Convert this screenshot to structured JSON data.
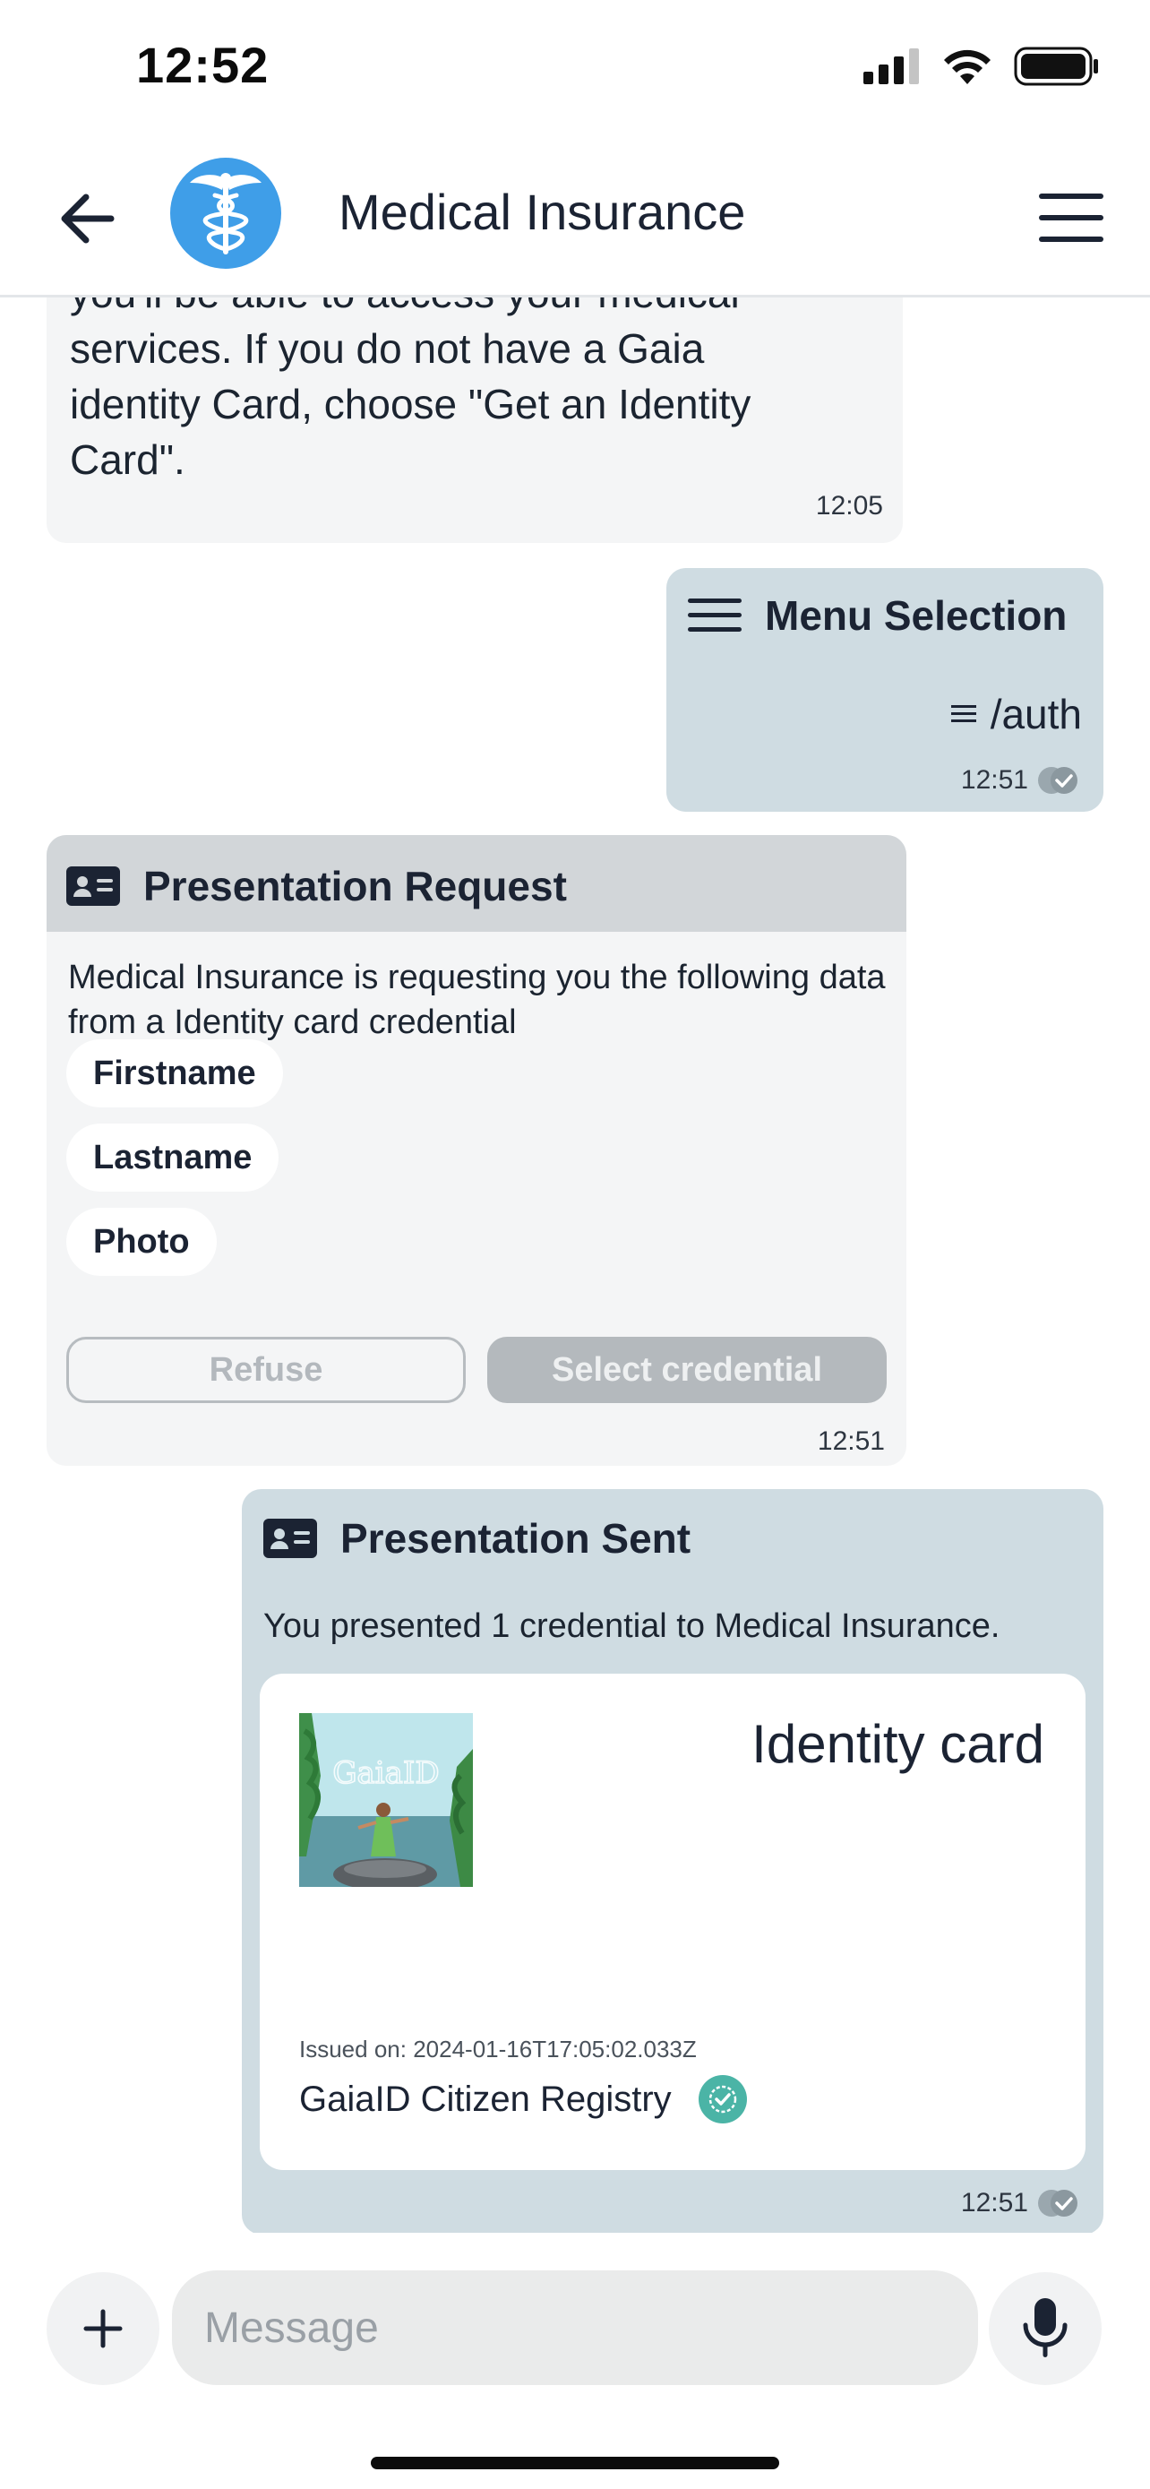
{
  "status_bar": {
    "time": "12:52"
  },
  "header": {
    "title": "Medical Insurance"
  },
  "messages": {
    "intro": {
      "line1": "you'll be able to access your medical",
      "line2": "services. If you do not have a Gaia",
      "line3": "identity Card, choose \"Get an Identity",
      "line4": "Card\".",
      "time": "12:05"
    },
    "menu_selection": {
      "title": "Menu Selection",
      "command": "/auth",
      "time": "12:51"
    },
    "presentation_request": {
      "title": "Presentation Request",
      "description": "Medical Insurance is requesting you the following data from a Identity card credential",
      "fields": [
        "Firstname",
        "Lastname",
        "Photo"
      ],
      "refuse_label": "Refuse",
      "select_label": "Select credential",
      "time": "12:51"
    },
    "presentation_sent": {
      "title": "Presentation Sent",
      "description": "You presented 1 credential to Medical Insurance.",
      "card": {
        "image_text": "GaiaID",
        "title": "Identity card",
        "issued": "Issued on: 2024-01-16T17:05:02.033Z",
        "issuer": "GaiaID Citizen Registry"
      },
      "time": "12:51"
    }
  },
  "composer": {
    "placeholder": "Message"
  },
  "colors": {
    "avatar": "#3f9ee8",
    "outgoing_bubble": "#cfdce2",
    "incoming_bubble": "#f4f5f6",
    "verified_badge": "#4bb4a6"
  },
  "icons": [
    "back-arrow-icon",
    "caduceus-icon",
    "hamburger-icon",
    "id-card-icon",
    "read-receipt-icon",
    "verified-icon",
    "plus-icon",
    "microphone-icon"
  ]
}
